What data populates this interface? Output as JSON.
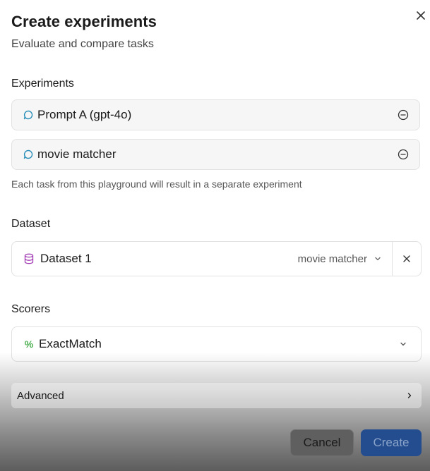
{
  "dialog": {
    "title": "Create experiments",
    "subtitle": "Evaluate and compare tasks"
  },
  "experiments": {
    "label": "Experiments",
    "items": [
      {
        "name": "Prompt A (gpt-4o)"
      },
      {
        "name": "movie matcher"
      }
    ],
    "hint": "Each task from this playground will result in a separate experiment"
  },
  "dataset": {
    "label": "Dataset",
    "name": "Dataset 1",
    "selected": "movie matcher"
  },
  "scorers": {
    "label": "Scorers",
    "selected": "ExactMatch",
    "icon_glyph": "%"
  },
  "advanced": {
    "label": "Advanced"
  },
  "footer": {
    "cancel_label": "Cancel",
    "create_label": "Create"
  },
  "colors": {
    "prompt_icon": "#2a8fb8",
    "dataset_icon": "#a23bb5",
    "scorer_icon": "#4caf50",
    "create_button": "#244d8f"
  }
}
